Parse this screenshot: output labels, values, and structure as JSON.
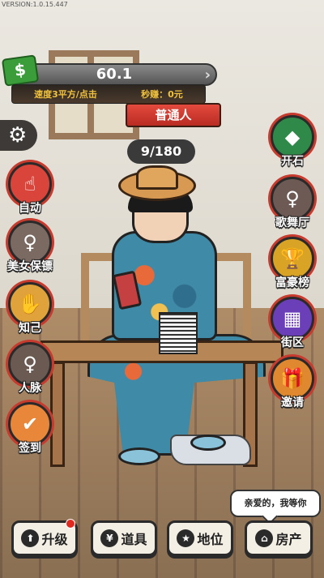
{
  "version_text": "VERSION:1.0.15.447",
  "hud": {
    "money_value": "60.1",
    "more_symbol": "›",
    "speed_text": "速度3平方/点击",
    "income_text": "秒赚：0元",
    "rank_title": "普通人",
    "progress_text": "9/180"
  },
  "left_buttons": [
    {
      "label": "自动",
      "icon": "auto-click-icon",
      "color": "#d9453a"
    },
    {
      "label": "美女保镖",
      "icon": "bodyguard-portrait-icon",
      "color": "#7a6a62"
    },
    {
      "label": "知己",
      "icon": "handshake-icon",
      "color": "#e0a23a"
    },
    {
      "label": "人脉",
      "icon": "contact-portrait-icon",
      "color": "#6b5a52"
    },
    {
      "label": "签到",
      "icon": "calendar-check-icon",
      "color": "#e8863a"
    }
  ],
  "right_buttons": [
    {
      "label": "开石",
      "icon": "jade-stone-icon",
      "color": "#2f8a4a"
    },
    {
      "label": "歌舞厅",
      "icon": "singer-portrait-icon",
      "color": "#6d5a55"
    },
    {
      "label": "富豪榜",
      "icon": "trophy-icon",
      "color": "#d9a325"
    },
    {
      "label": "街区",
      "icon": "city-block-icon",
      "color": "#6a3fb8"
    },
    {
      "label": "邀请",
      "icon": "gift-box-icon",
      "color": "#e0882f"
    }
  ],
  "bottom_nav": [
    {
      "label": "升级",
      "icon": "upgrade-icon"
    },
    {
      "label": "道具",
      "icon": "piggy-bank-icon"
    },
    {
      "label": "地位",
      "icon": "medal-icon"
    },
    {
      "label": "房产",
      "icon": "house-icon"
    }
  ],
  "speech_bubble": "亲爱的，我等你"
}
